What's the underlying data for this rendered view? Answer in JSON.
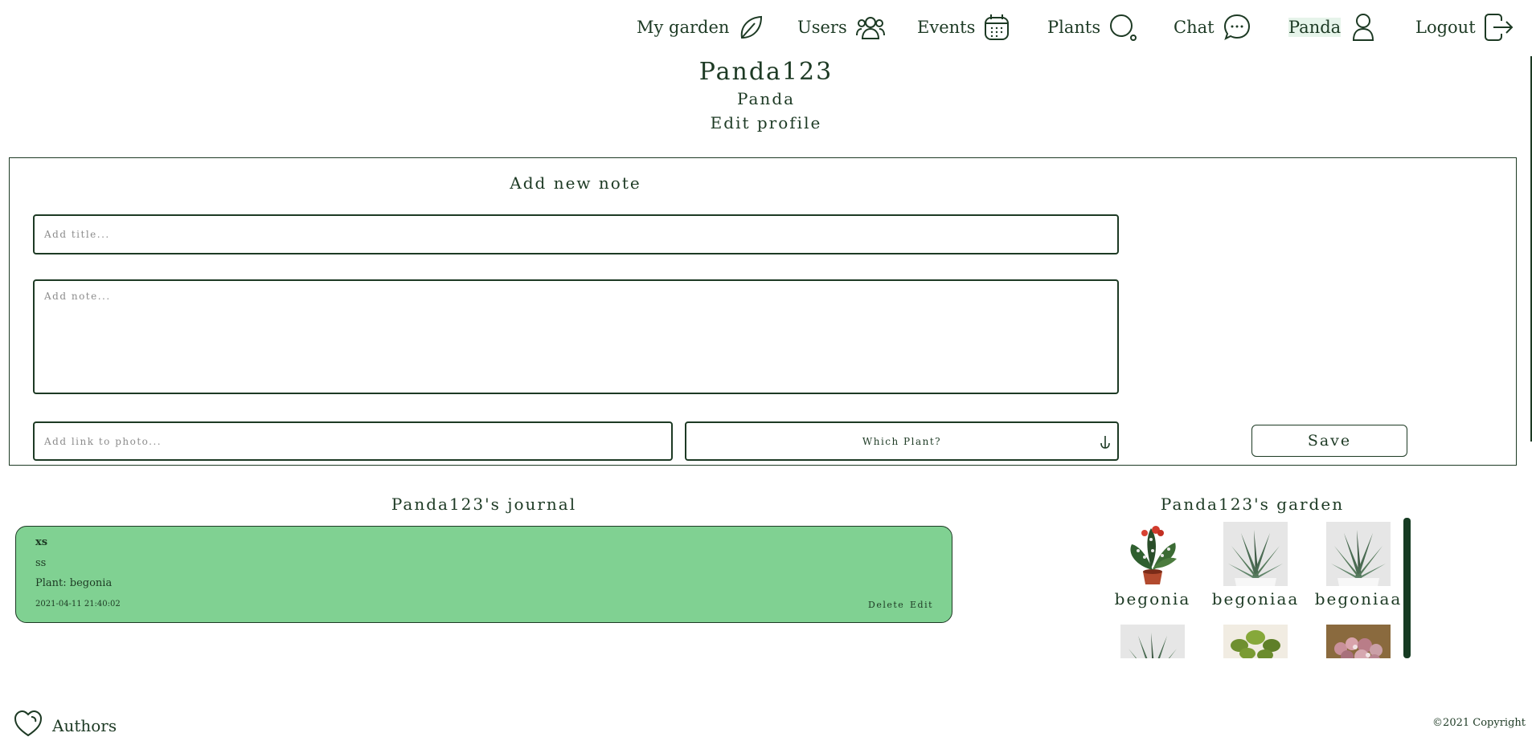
{
  "nav": {
    "items": [
      {
        "label": "My garden",
        "icon": "leaf-icon"
      },
      {
        "label": "Users",
        "icon": "users-icon"
      },
      {
        "label": "Events",
        "icon": "calendar-icon"
      },
      {
        "label": "Plants",
        "icon": "search-icon"
      },
      {
        "label": "Chat",
        "icon": "chat-icon"
      },
      {
        "label": "Panda",
        "icon": "user-icon"
      },
      {
        "label": "Logout",
        "icon": "logout-icon"
      }
    ],
    "active": "Panda"
  },
  "profile": {
    "username": "Panda123",
    "name": "Panda",
    "edit_label": "Edit profile"
  },
  "form": {
    "title": "Add new note",
    "title_placeholder": "Add title...",
    "note_placeholder": "Add note...",
    "photo_placeholder": "Add link to photo...",
    "plant_select": "Which Plant?",
    "save_label": "Save"
  },
  "journal": {
    "title": "Panda123's journal",
    "notes": [
      {
        "title": "xs",
        "body": "ss",
        "plant": "Plant: begonia",
        "date": "2021-04-11 21:40:02",
        "delete_label": "Delete",
        "edit_label": "Edit"
      }
    ]
  },
  "garden": {
    "title": "Panda123's garden",
    "plants": [
      {
        "name": "begonia",
        "image": "begonia-plant"
      },
      {
        "name": "begoniaa",
        "image": "aloe-plant"
      },
      {
        "name": "begoniaa",
        "image": "aloe-plant"
      },
      {
        "name": "",
        "image": "aloe-plant"
      },
      {
        "name": "",
        "image": "pothos-plant"
      },
      {
        "name": "",
        "image": "pink-succulent-plant"
      }
    ]
  },
  "footer": {
    "authors_label": "Authors",
    "copyright": "©2021 Copyright"
  },
  "colors": {
    "primary": "#1d3a24",
    "note_bg": "#80d192",
    "scrollbar": "#163b22"
  }
}
